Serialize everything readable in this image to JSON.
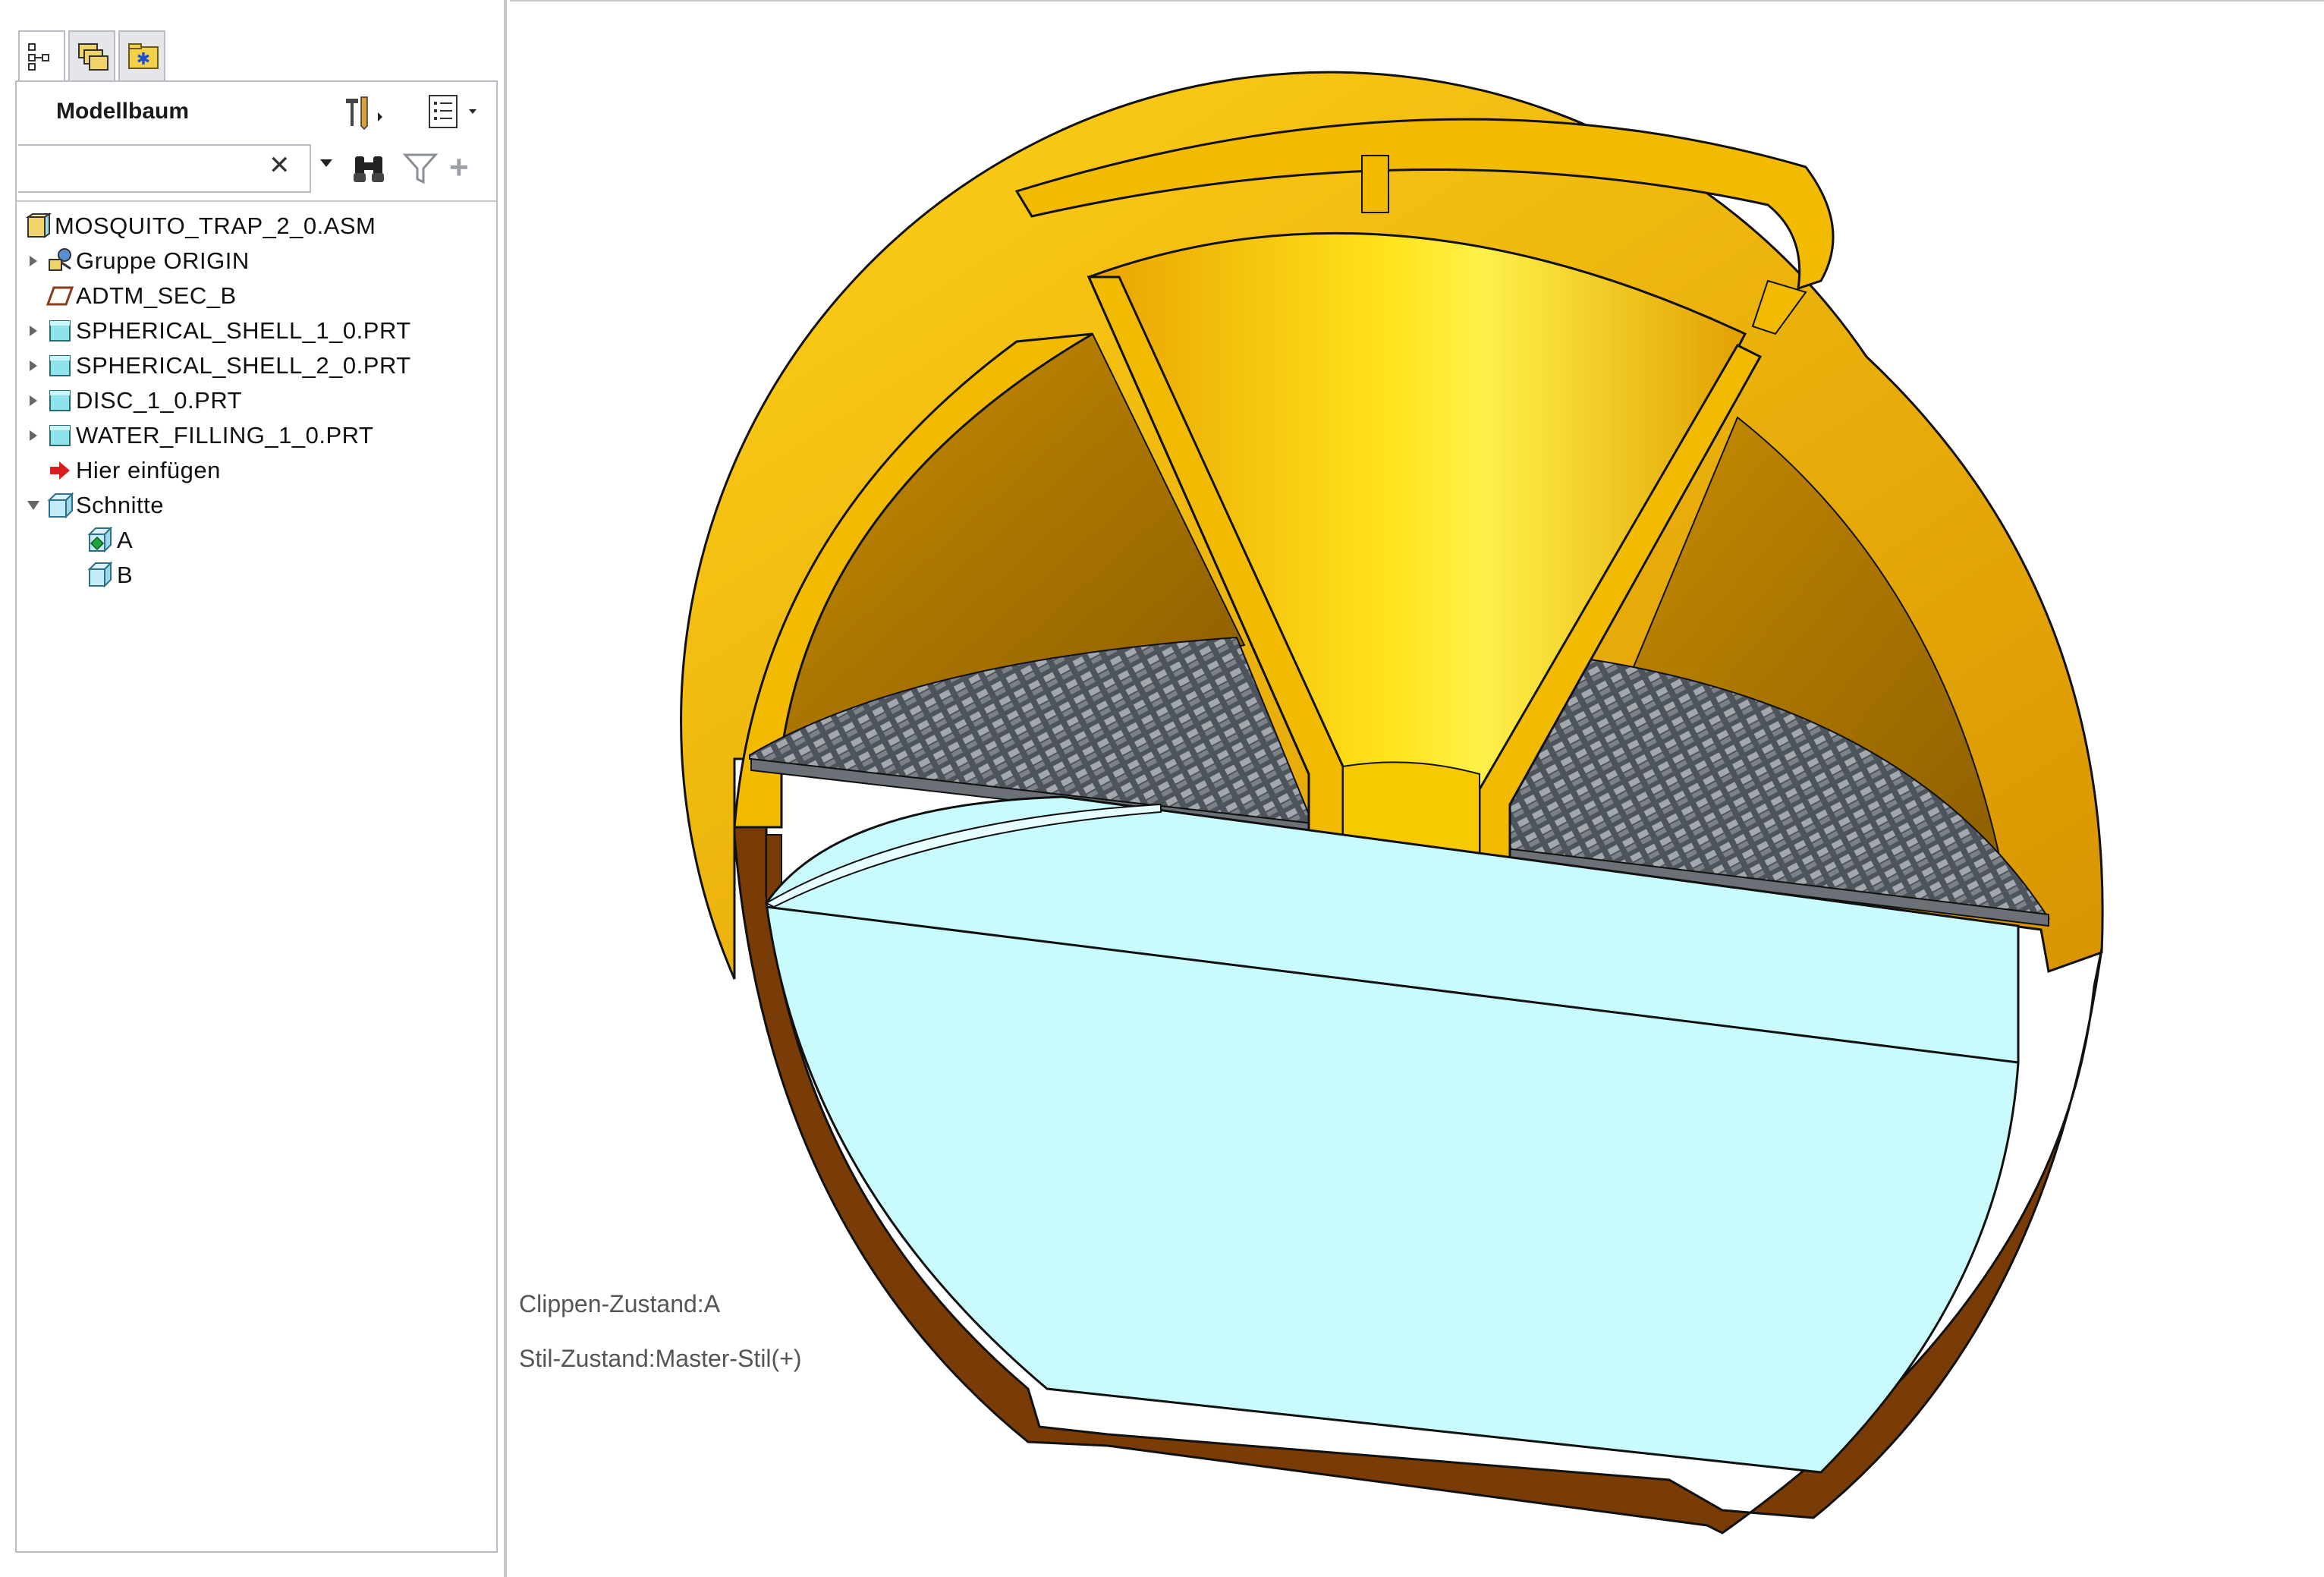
{
  "model_tree": {
    "tabs": [
      {
        "name": "model-tree-tab",
        "icon": "model-tree-icon"
      },
      {
        "name": "layers-tab",
        "icon": "layers-icon"
      },
      {
        "name": "favorites-tab",
        "icon": "folder-star-icon"
      }
    ],
    "title": "Modellbaum",
    "search": {
      "value": "",
      "placeholder": ""
    },
    "items": [
      {
        "label": "MOSQUITO_TRAP_2_0.ASM",
        "icon": "assembly-icon",
        "level": 0,
        "expander": "none"
      },
      {
        "label": "Gruppe ORIGIN",
        "icon": "group-icon",
        "level": 1,
        "expander": "collapsed"
      },
      {
        "label": "ADTM_SEC_B",
        "icon": "datum-plane-icon",
        "level": 1,
        "expander": "none"
      },
      {
        "label": "SPHERICAL_SHELL_1_0.PRT",
        "icon": "part-icon",
        "level": 1,
        "expander": "collapsed"
      },
      {
        "label": "SPHERICAL_SHELL_2_0.PRT",
        "icon": "part-icon",
        "level": 1,
        "expander": "collapsed"
      },
      {
        "label": "DISC_1_0.PRT",
        "icon": "part-icon",
        "level": 1,
        "expander": "collapsed"
      },
      {
        "label": "WATER_FILLING_1_0.PRT",
        "icon": "part-icon",
        "level": 1,
        "expander": "collapsed"
      },
      {
        "label": "Hier einfügen",
        "icon": "insert-arrow-icon",
        "level": 1,
        "expander": "none"
      },
      {
        "label": "Schnitte",
        "icon": "sections-icon",
        "level": 1,
        "expander": "expanded"
      },
      {
        "label": "A",
        "icon": "section-active-icon",
        "level": 2,
        "expander": "none"
      },
      {
        "label": "B",
        "icon": "section-icon",
        "level": 2,
        "expander": "none"
      }
    ]
  },
  "viewport": {
    "clip_state": "Clippen-Zustand:A",
    "style_state": "Stil-Zustand:Master-Stil(+)"
  },
  "colors": {
    "yellow_part": "#f2bb00",
    "brown_part": "#7a3c06",
    "water": "#c9fbfd",
    "mesh": "#5d6269"
  }
}
